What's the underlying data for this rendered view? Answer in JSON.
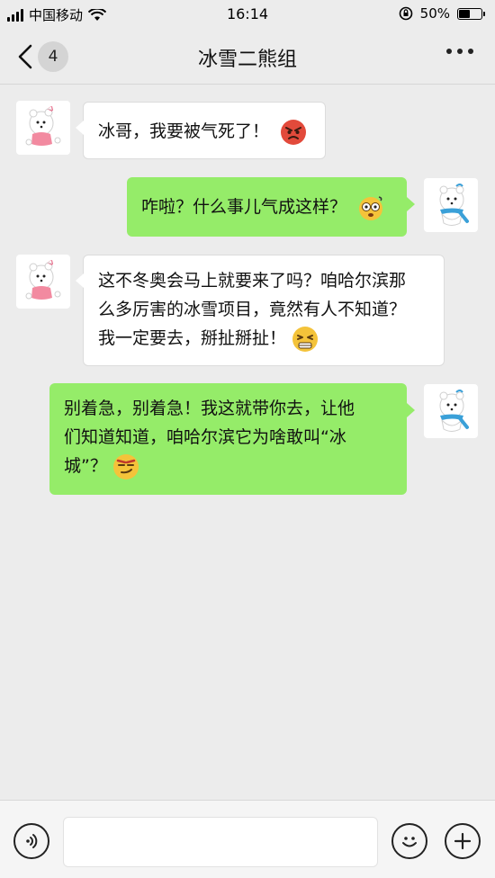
{
  "status_bar": {
    "carrier": "中国移动",
    "time": "16:14",
    "battery": "50%",
    "battery_level": 0.5
  },
  "nav": {
    "unread_count": "4",
    "title": "冰雪二熊组"
  },
  "messages": [
    {
      "side": "left",
      "lines": [
        "冰哥，我要被气死了！"
      ],
      "emoji": "angry-face-emoji"
    },
    {
      "side": "right",
      "lines": [
        "咋啦？什么事儿气成这样？"
      ],
      "emoji": "dizzy-face-emoji"
    },
    {
      "side": "left",
      "lines": [
        "这不冬奥会马上就要来了吗？咱哈尔滨那",
        "么多厉害的冰雪项目，竟然有人不知道？",
        "我一定要去，掰扯掰扯！"
      ],
      "emoji": "frustrated-face-emoji"
    },
    {
      "side": "right",
      "lines": [
        "别着急，别着急！我这就带你去，让他",
        "们知道知道，咱哈尔滨它为啥敢叫“冰",
        "城”？"
      ],
      "emoji": "smirk-face-emoji"
    }
  ],
  "input": {
    "placeholder": ""
  },
  "colors": {
    "background": "#ececec",
    "bubble_green": "#95ec69",
    "bubble_white": "#ffffff"
  },
  "icons": {
    "voice": "voice-icon",
    "emoji": "emoji-icon",
    "add": "plus-icon"
  }
}
